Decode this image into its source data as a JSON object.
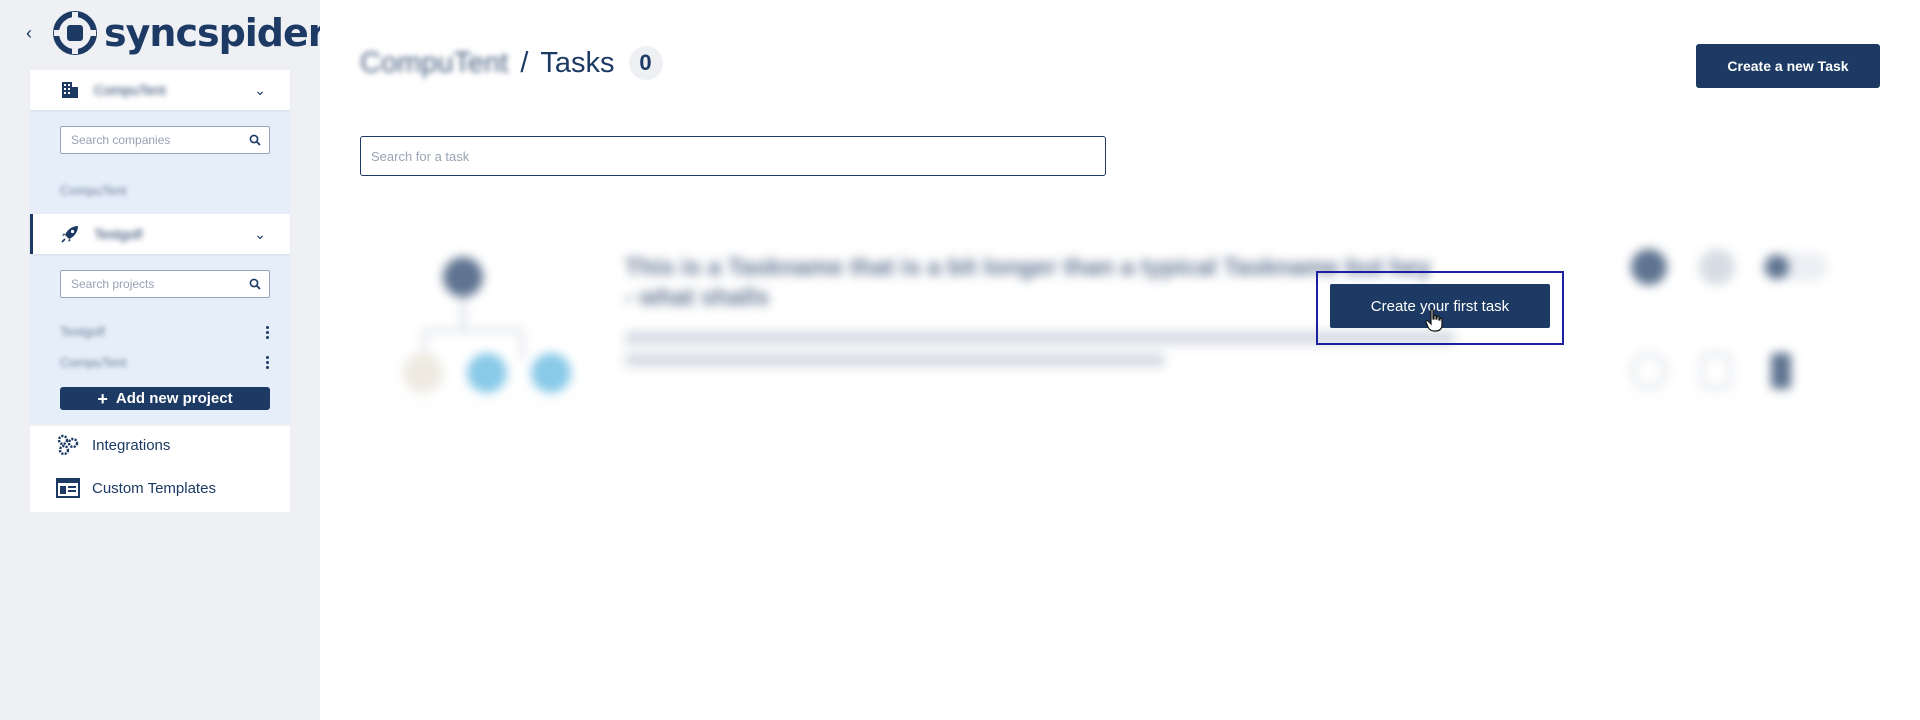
{
  "brand": {
    "name": "syncspider"
  },
  "sidebar": {
    "company_selector": {
      "label": "CompuTent"
    },
    "company_search": {
      "placeholder": "Search companies"
    },
    "companies": [
      {
        "label": "CompuTent"
      }
    ],
    "project_selector": {
      "label": "Testgolf"
    },
    "project_search": {
      "placeholder": "Search projects"
    },
    "projects": [
      {
        "label": "Testgolf"
      },
      {
        "label": "CompuTent"
      }
    ],
    "add_project_label": "Add new project",
    "nav": [
      {
        "label": "Integrations",
        "icon": "gears-icon"
      },
      {
        "label": "Custom Templates",
        "icon": "template-icon"
      }
    ]
  },
  "header": {
    "company": "CompuTent",
    "separator": "/",
    "title": "Tasks",
    "count": "0",
    "create_button": "Create a new Task"
  },
  "search": {
    "placeholder": "Search for a task"
  },
  "empty_state": {
    "ghost_title": "This is a Taskname that is a bit longer than a typical Taskname but hey - what shalls",
    "cta_label": "Create your first task"
  },
  "colors": {
    "primary": "#1c3a63",
    "sidebar_bg": "#eef0f4",
    "highlight": "#1b1fa0"
  }
}
